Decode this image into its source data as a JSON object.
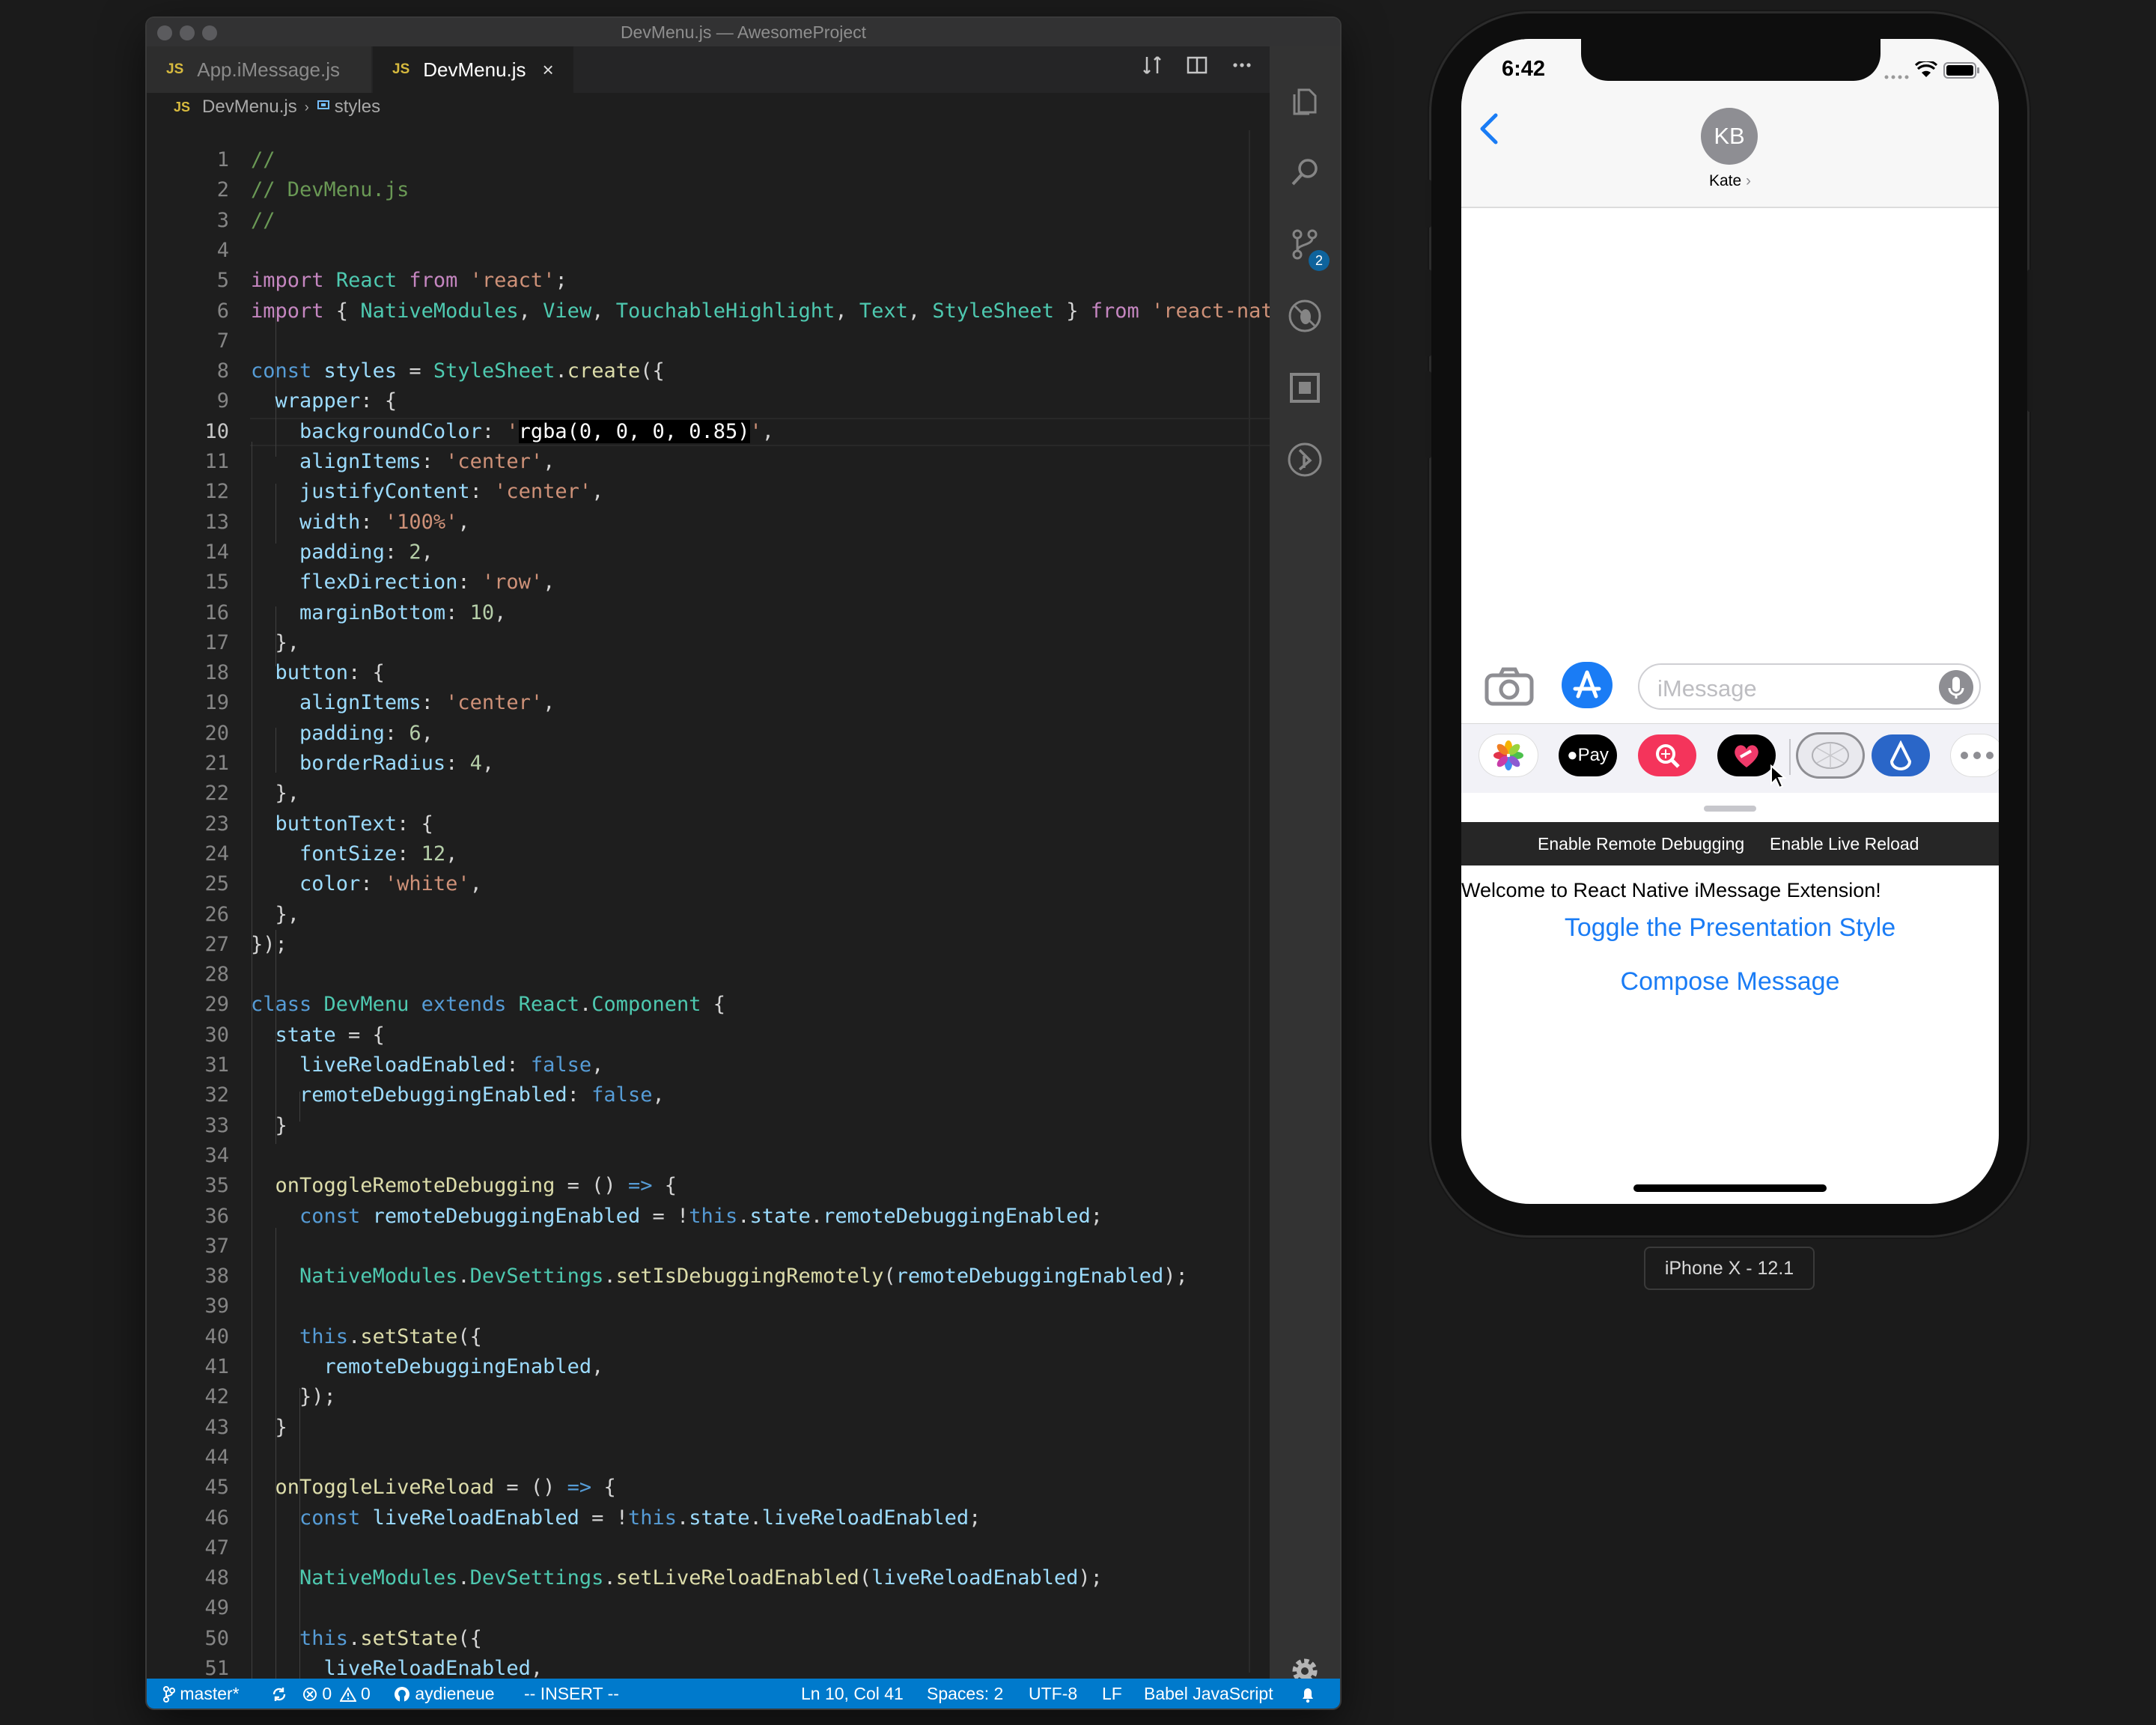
{
  "window": {
    "title": "DevMenu.js — AwesomeProject"
  },
  "tabs": [
    {
      "icon": "JS",
      "label": "App.iMessage.js"
    },
    {
      "icon": "JS",
      "label": "DevMenu.js",
      "close": "×"
    }
  ],
  "breadcrumb": {
    "file": "DevMenu.js",
    "separator": "›",
    "symbol": "styles"
  },
  "editor": {
    "current_line": 10,
    "line_numbers": [
      "1",
      "2",
      "3",
      "4",
      "5",
      "6",
      "7",
      "8",
      "9",
      "10",
      "11",
      "12",
      "13",
      "14",
      "15",
      "16",
      "17",
      "18",
      "19",
      "20",
      "21",
      "22",
      "23",
      "24",
      "25",
      "26",
      "27",
      "28",
      "29",
      "30",
      "31",
      "32",
      "33",
      "34",
      "35",
      "36",
      "37",
      "38",
      "39",
      "40",
      "41",
      "42",
      "43",
      "44",
      "45",
      "46",
      "47",
      "48",
      "49",
      "50",
      "51"
    ],
    "code_lines": [
      "//",
      "// DevMenu.js",
      "//",
      "",
      "import React from 'react';",
      "import { NativeModules, View, TouchableHighlight, Text, StyleSheet } from 'react-nat",
      "",
      "const styles = StyleSheet.create({",
      "  wrapper: {",
      "    backgroundColor: 'rgba(0, 0, 0, 0.85)',",
      "    alignItems: 'center',",
      "    justifyContent: 'center',",
      "    width: '100%',",
      "    padding: 2,",
      "    flexDirection: 'row',",
      "    marginBottom: 10,",
      "  },",
      "  button: {",
      "    alignItems: 'center',",
      "    padding: 6,",
      "    borderRadius: 4,",
      "  },",
      "  buttonText: {",
      "    fontSize: 12,",
      "    color: 'white',",
      "  },",
      "});",
      "",
      "class DevMenu extends React.Component {",
      "  state = {",
      "    liveReloadEnabled: false,",
      "    remoteDebuggingEnabled: false,",
      "  }",
      "",
      "  onToggleRemoteDebugging = () => {",
      "    const remoteDebuggingEnabled = !this.state.remoteDebuggingEnabled;",
      "",
      "    NativeModules.DevSettings.setIsDebuggingRemotely(remoteDebuggingEnabled);",
      "",
      "    this.setState({",
      "      remoteDebuggingEnabled,",
      "    });",
      "  }",
      "",
      "  onToggleLiveReload = () => {",
      "    const liveReloadEnabled = !this.state.liveReloadEnabled;",
      "",
      "    NativeModules.DevSettings.setLiveReloadEnabled(liveReloadEnabled);",
      "",
      "    this.setState({",
      "      liveReloadEnabled,"
    ]
  },
  "activity_bar": {
    "icons": [
      "explorer-icon",
      "search-icon",
      "source-control-icon",
      "debug-icon",
      "extensions-icon",
      "remote-icon"
    ],
    "source_control_badge": "2",
    "settings_icon": "gear-icon"
  },
  "status_bar": {
    "branch": "master*",
    "errors": "0",
    "warnings": "0",
    "user": "aydieneue",
    "mode": "-- INSERT --",
    "position": "Ln 10, Col 41",
    "indent": "Spaces: 2",
    "encoding": "UTF-8",
    "eol": "LF",
    "language": "Babel JavaScript"
  },
  "simulator": {
    "time": "6:42",
    "contact_initials": "KB",
    "contact_name": "Kate",
    "contact_chevron": "›",
    "input_placeholder": "iMessage",
    "apps": [
      "photos-app-icon",
      "apple-pay-icon",
      "search-images-icon",
      "heart-sticker-icon",
      "digital-touch-icon",
      "app-extension-icon",
      "more-apps-icon"
    ],
    "apple_pay_label": "Pay",
    "dev_menu": {
      "remote_debugging": "Enable Remote Debugging",
      "live_reload": "Enable Live Reload"
    },
    "welcome": "Welcome to React Native iMessage Extension!",
    "toggle_button": "Toggle the Presentation Style",
    "compose_button": "Compose Message",
    "device_label": "iPhone X - 12.1"
  }
}
